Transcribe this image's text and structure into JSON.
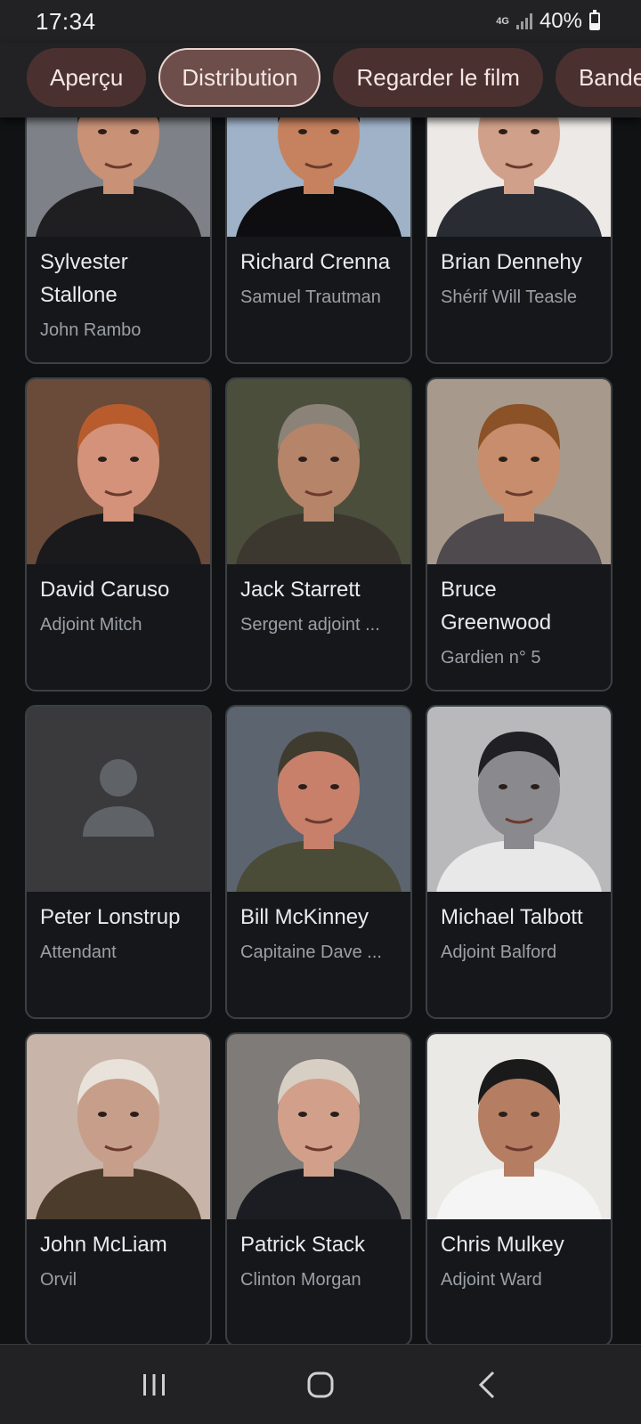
{
  "status": {
    "time": "17:34",
    "network": "4G",
    "battery": "40%",
    "battery_level": 0.4
  },
  "tabs": [
    {
      "label": "Aperçu",
      "active": false
    },
    {
      "label": "Distribution",
      "active": true
    },
    {
      "label": "Regarder le film",
      "active": false
    },
    {
      "label": "Bande",
      "active": false
    }
  ],
  "cast": [
    {
      "name": "Sylvester Stallone",
      "role": "John Rambo",
      "photo": "portrait-photo"
    },
    {
      "name": "Richard Crenna",
      "role": "Samuel Trautman",
      "photo": "portrait-photo"
    },
    {
      "name": "Brian Dennehy",
      "role": "Shérif Will Teasle",
      "photo": "portrait-photo"
    },
    {
      "name": "David Caruso",
      "role": "Adjoint Mitch",
      "photo": "portrait-photo"
    },
    {
      "name": "Jack Starrett",
      "role": "Sergent adjoint ...",
      "photo": "portrait-photo"
    },
    {
      "name": "Bruce Greenwood",
      "role": "Gardien n° 5",
      "photo": "portrait-photo"
    },
    {
      "name": "Peter Lonstrup",
      "role": "Attendant",
      "photo": "person-placeholder-icon"
    },
    {
      "name": "Bill McKinney",
      "role": "Capitaine Dave ...",
      "photo": "portrait-photo"
    },
    {
      "name": "Michael Talbott",
      "role": "Adjoint Balford",
      "photo": "portrait-photo"
    },
    {
      "name": "John McLiam",
      "role": "Orvil",
      "photo": "portrait-photo"
    },
    {
      "name": "Patrick Stack",
      "role": "Clinton Morgan",
      "photo": "portrait-photo"
    },
    {
      "name": "Chris Mulkey",
      "role": "Adjoint Ward",
      "photo": "portrait-photo"
    }
  ],
  "nav": {
    "recents": "recents-icon",
    "home": "home-icon",
    "back": "back-icon"
  },
  "colors": {
    "background": "#111214",
    "chip": "#4a3130",
    "chip_active": "#6e4e4a",
    "card_border": "#3c4043"
  }
}
